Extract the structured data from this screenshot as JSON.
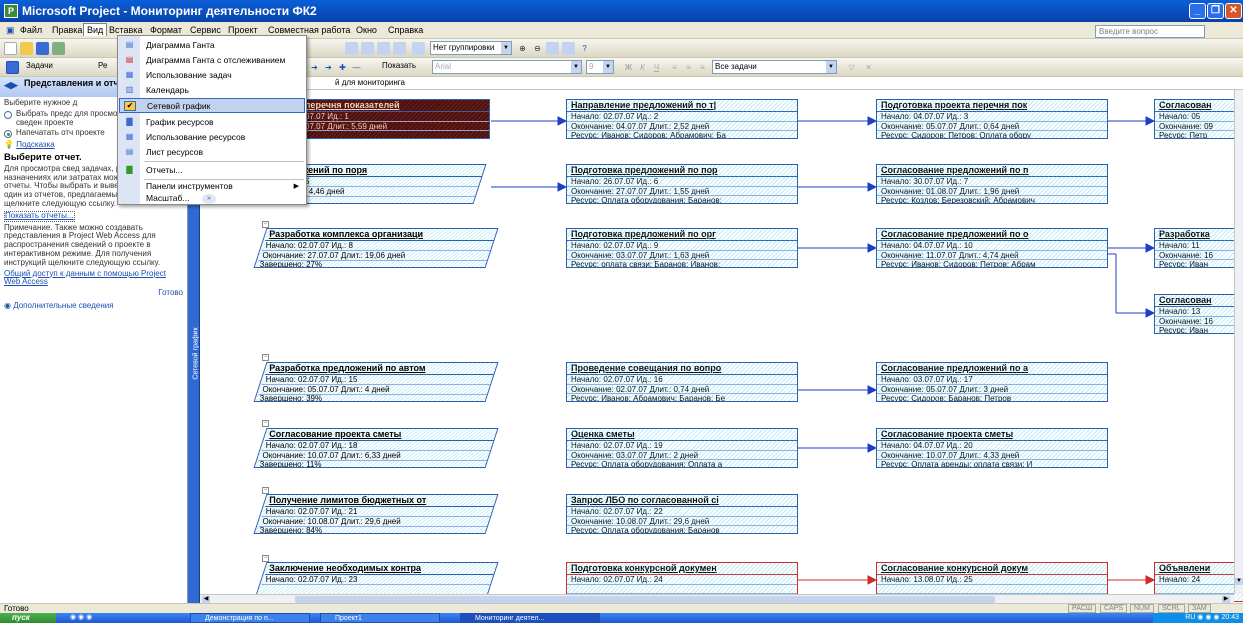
{
  "window": {
    "title": "Microsoft Project - Мониторинг деятельности ФК2",
    "minimize": "_",
    "restore": "❐",
    "close": "✕"
  },
  "menu": {
    "items": [
      "Файл",
      "Правка",
      "Вид",
      "Вставка",
      "Формат",
      "Сервис",
      "Проект",
      "Совместная работа",
      "Окно",
      "Справка"
    ],
    "help_placeholder": "Введите вопрос"
  },
  "toolbar": {
    "grouping": "Нет группировки",
    "tasks_btn": "Задачи",
    "resources_btn": "Ре",
    "show_btn": "Показать",
    "font": "Arial",
    "font_size": "9",
    "filter": "Все задачи",
    "bold": "Ж",
    "italic": "К",
    "underline": "Ч"
  },
  "entry_bar": {
    "text": "й для мониторинга"
  },
  "view_menu": {
    "items": [
      {
        "label": "Диаграмма Ганта"
      },
      {
        "label": "Диаграмма Ганта с отслеживанием"
      },
      {
        "label": "Использование задач"
      },
      {
        "label": "Календарь"
      },
      {
        "label": "Сетевой график"
      },
      {
        "label": "График ресурсов"
      },
      {
        "label": "Использование ресурсов"
      },
      {
        "label": "Лист ресурсов"
      },
      {
        "label": "Отчеты..."
      },
      {
        "label": "Панели инструментов"
      },
      {
        "label": "Масштаб..."
      }
    ],
    "selected": "Сетевой график",
    "more": "»"
  },
  "task_pane": {
    "header": "Представления и отчеты",
    "intro": "Выберите нужное д",
    "option1": "Выбрать предс для просмотра анализа сведен проекте",
    "option2": "Напечатать отч проекте",
    "hint_link": "Подсказка",
    "section": "Выберите отчет.",
    "body": "Для просмотра свед задачах, ресурсах, назначениях или затратах можно создавать отчеты. Чтобы выбрать и вывести на печать один из отчетов, предлагаемых Project, щелкните следующую ссылку.",
    "show_reports": "Показать отчеты...",
    "note": "Примечание. Также можно создавать представления в Project Web Access для распространения сведений о проекте в интерактивном режиме. Для получения инструкций щелкните следующую ссылку.",
    "pwa_link": "Общий доступ к данным с помощью Project Web Access",
    "done": "Готово",
    "more_info": "Дополнительные сведения"
  },
  "view_bar_label": "Сетевой график",
  "nodes": [
    {
      "title": "перечня показателей",
      "r1": "07.07  Ид.:   1",
      "r2": "07.07  Длит.: 5,59 дней",
      "r3": ""
    },
    {
      "title": "Направление предложений по т|",
      "r1": "Начало:     02.07.07  Ид.:   2",
      "r2": "Окончание: 04.07.07  Длит.: 2,52 дней",
      "r3": "Ресурс:   Иванов; Сидоров; Абрамович; Ба"
    },
    {
      "title": "Подготовка проекта перечня пок",
      "r1": "Начало:     04.07.07  Ид.:   3",
      "r2": "Окончание: 05.07.07  Длит.: 0,64 дней",
      "r3": "Ресурс:   Сидоров; Петров; Оплата обору"
    },
    {
      "title": "Согласован",
      "r1": "Начало:    05",
      "r2": "Окончание: 09",
      "r3": "Ресурс:   Петр"
    },
    {
      "title": "предложений по поря",
      "r1": "07.07  Ид.:   5",
      "r2": "08.07  Длит.: 4,46 дней",
      "r3": ""
    },
    {
      "title": "Подготовка предложений по пор",
      "r1": "Начало:     26.07.07  Ид.:   6",
      "r2": "Окончание: 27.07.07  Длит.: 1,55 дней",
      "r3": "Ресурс:   Оплата оборудования; Баранов;"
    },
    {
      "title": "Согласование предложений по п",
      "r1": "Начало:     30.07.07  Ид.:   7",
      "r2": "Окончание: 01.08.07  Длит.: 1,96 дней",
      "r3": "Ресурс:   Козлов; Березовский; Абрамович"
    },
    {
      "title": "Разработка комплекса организаци",
      "r1": "Начало:     02.07.07  Ид.:   8",
      "r2": "Окончание: 27.07.07  Длит.: 19,06 дней",
      "r3": "Завершено: 27%"
    },
    {
      "title": "Подготовка предложений по орг",
      "r1": "Начало:     02.07.07  Ид.:   9",
      "r2": "Окончание: 03.07.07  Длит.: 1,63 дней",
      "r3": "Ресурс:   оплата связи; Баранов; Иванов;"
    },
    {
      "title": "Согласование предложений по о",
      "r1": "Начало:     04.07.07  Ид.:   10",
      "r2": "Окончание: 11.07.07  Длит.: 4,74 дней",
      "r3": "Ресурс:   Иванов; Сидоров; Петров; Абрам"
    },
    {
      "title": "Разработка",
      "r1": "Начало:    11",
      "r2": "Окончание: 16",
      "r3": "Ресурс:   Иван"
    },
    {
      "title": "Согласован",
      "r1": "Начало:    13",
      "r2": "Окончание: 16",
      "r3": "Ресурс:   Иван"
    },
    {
      "title": "Разработка предложений по автом",
      "r1": "Начало:     02.07.07  Ид.:   15",
      "r2": "Окончание: 05.07.07  Длит.: 4 дней",
      "r3": "Завершено: 39%"
    },
    {
      "title": "Проведение совещания по вопро",
      "r1": "Начало:     02.07.07  Ид.:   16",
      "r2": "Окончание: 02.07.07  Длит.: 0,74 дней",
      "r3": "Ресурс:   Иванов; Абрамович; Баранов; Бе"
    },
    {
      "title": "Согласование предложений по а",
      "r1": "Начало:     03.07.07  Ид.:   17",
      "r2": "Окончание: 05.07.07  Длит.: 3 дней",
      "r3": "Ресурс:   Сидоров; Баранов; Петров"
    },
    {
      "title": "Согласование проекта сметы",
      "r1": "Начало:     02.07.07  Ид.:   18",
      "r2": "Окончание: 10.07.07  Длит.: 6,33 дней",
      "r3": "Завершено: 11%"
    },
    {
      "title": "Оценка сметы",
      "r1": "Начало:     02.07.07  Ид.:   19",
      "r2": "Окончание: 03.07.07  Длит.: 2 дней",
      "r3": "Ресурс:   Оплата оборудования; Оплата а"
    },
    {
      "title": "Согласование проекта сметы",
      "r1": "Начало:     04.07.07  Ид.:   20",
      "r2": "Окончание: 10.07.07  Длит.: 4,33 дней",
      "r3": "Ресурс:   Оплата аренды; оплата связи; И"
    },
    {
      "title": "Получение лимитов бюджетных от",
      "r1": "Начало:     02.07.07  Ид.:   21",
      "r2": "Окончание: 10.08.07  Длит.: 29,6 дней",
      "r3": "Завершено: 84%"
    },
    {
      "title": "Запрос ЛБО по согласованной сі",
      "r1": "Начало:     02.07.07  Ид.:   22",
      "r2": "Окончание: 10.08.07  Длит.: 29,6 дней",
      "r3": "Ресурс:   Оплата оборудования; Баранов"
    },
    {
      "title": "Заключение необходимых контра",
      "r1": "Начало:     02.07.07  Ид.:   23",
      "r2": "",
      "r3": ""
    },
    {
      "title": "Подготовка конкурсной докумен",
      "r1": "Начало:     02.07.07  Ид.:   24",
      "r2": "",
      "r3": ""
    },
    {
      "title": "Согласование конкурсной докум",
      "r1": "Начало:     13.08.07  Ид.:   25",
      "r2": "",
      "r3": ""
    },
    {
      "title": "Объявлени",
      "r1": "Начало:    24",
      "r2": "",
      "r3": ""
    }
  ],
  "status": {
    "ready": "Готово",
    "indicators": [
      "РАСШ",
      "CAPS",
      "NUM",
      "SCRL",
      "ЗАМ"
    ]
  },
  "taskbar": {
    "start": "пуск",
    "tasks": [
      "Демонстрация по п...",
      "Проект1",
      "Мониторинг деятел..."
    ],
    "lang": "RU",
    "time": "20:43"
  }
}
